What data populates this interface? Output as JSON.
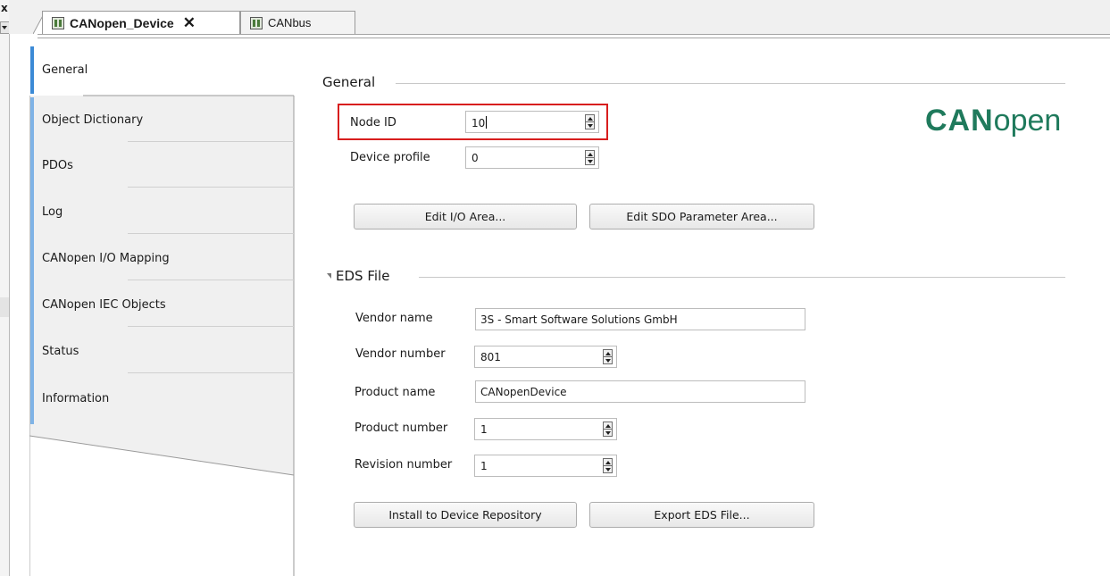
{
  "tabs": [
    {
      "label": "CANopen_Device",
      "active": true
    },
    {
      "label": "CANbus",
      "active": false
    }
  ],
  "sidebar": {
    "items": [
      {
        "label": "General",
        "active": true
      },
      {
        "label": "Object Dictionary"
      },
      {
        "label": "PDOs"
      },
      {
        "label": "Log"
      },
      {
        "label": "CANopen I/O Mapping"
      },
      {
        "label": "CANopen IEC Objects"
      },
      {
        "label": "Status"
      },
      {
        "label": "Information"
      }
    ]
  },
  "general": {
    "title": "General",
    "node_id_label": "Node ID",
    "node_id_value": "10",
    "device_profile_label": "Device profile",
    "device_profile_value": "0",
    "edit_io_button": "Edit I/O Area...",
    "edit_sdo_button": "Edit SDO Parameter Area..."
  },
  "logo": {
    "bold": "CAN",
    "light": "open",
    "color": "#1f7a5c"
  },
  "eds": {
    "title": "EDS File",
    "vendor_name_label": "Vendor name",
    "vendor_name_value": "3S - Smart Software Solutions GmbH",
    "vendor_number_label": "Vendor number",
    "vendor_number_value": "801",
    "product_name_label": "Product name",
    "product_name_value": "CANopenDevice",
    "product_number_label": "Product number",
    "product_number_value": "1",
    "revision_number_label": "Revision number",
    "revision_number_value": "1",
    "install_button": "Install to Device Repository",
    "export_button": "Export EDS File..."
  },
  "colors": {
    "highlight": "#d81e1e",
    "accent": "#3c8ad6"
  }
}
